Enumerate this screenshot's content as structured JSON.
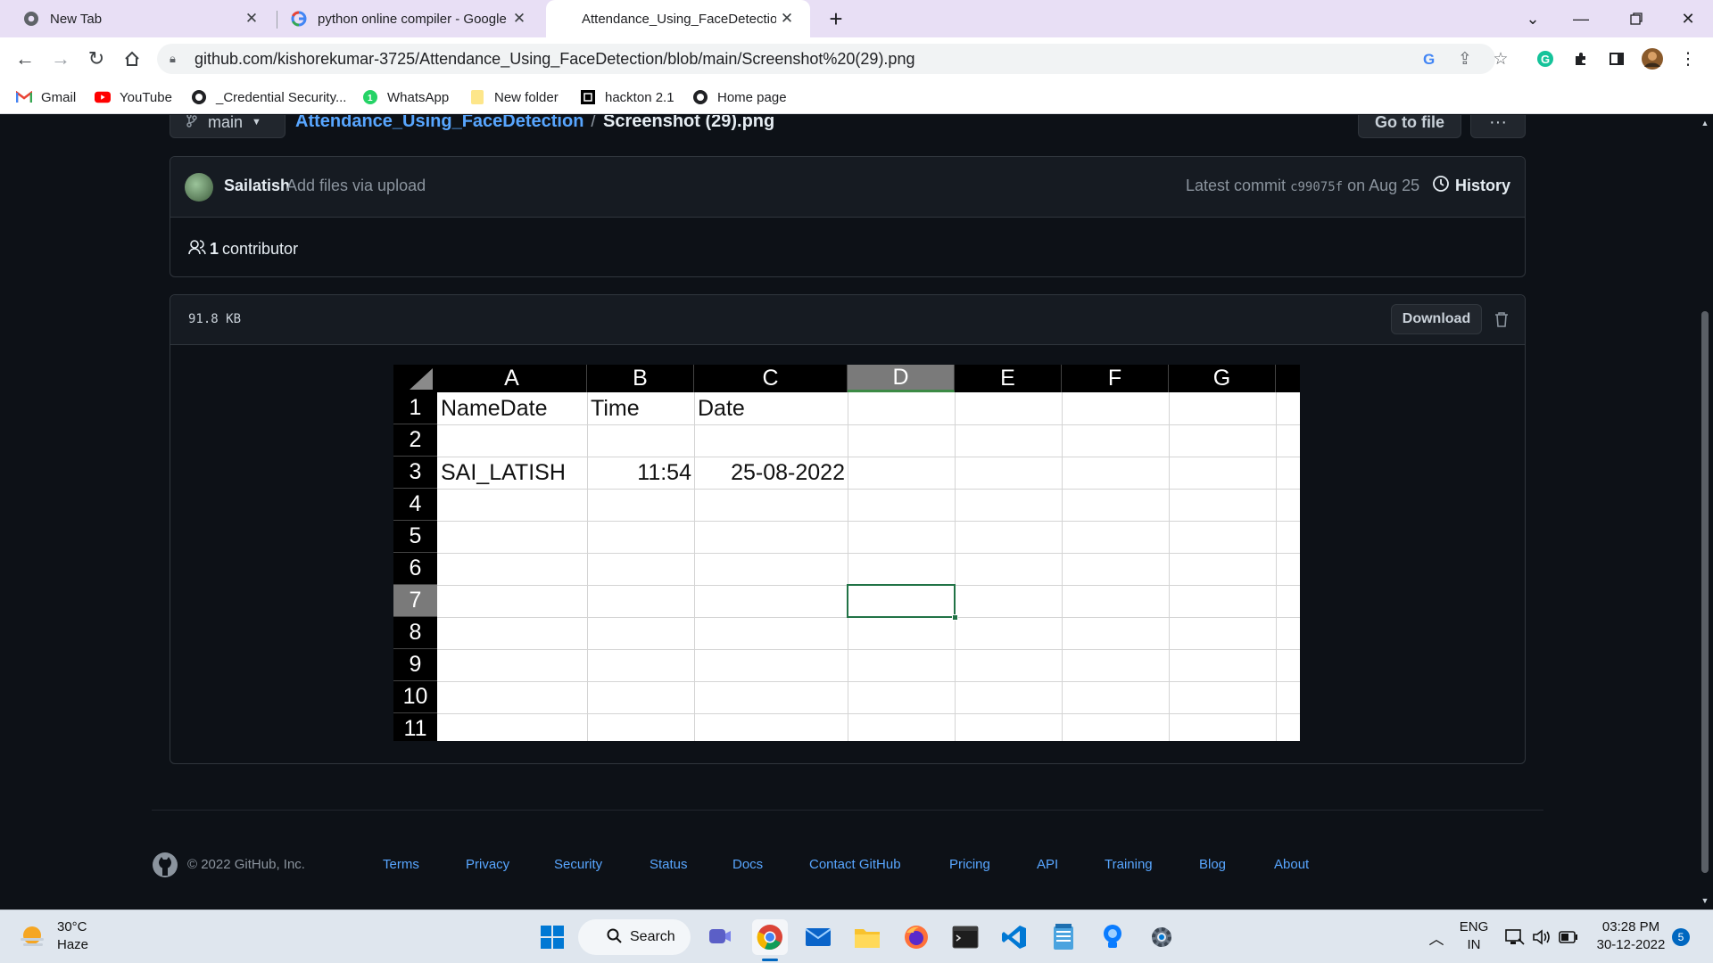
{
  "browser": {
    "tabs": [
      {
        "title": "New Tab"
      },
      {
        "title": "python online compiler - Google"
      },
      {
        "title": "Attendance_Using_FaceDetection"
      }
    ],
    "url": "github.com/kishorekumar-3725/Attendance_Using_FaceDetection/blob/main/Screenshot%20(29).png",
    "bookmarks": [
      {
        "label": "Gmail"
      },
      {
        "label": "YouTube"
      },
      {
        "label": "_Credential Security..."
      },
      {
        "label": "WhatsApp"
      },
      {
        "label": "New folder"
      },
      {
        "label": "hackton 2.1"
      },
      {
        "label": "Home page"
      }
    ]
  },
  "repo": {
    "branch": "main",
    "repo_name": "Attendance_Using_FaceDetection",
    "separator": "/",
    "file_name": "Screenshot (29).png",
    "go_to_file": "Go to file",
    "more": "···"
  },
  "commit": {
    "author": "Sailatish",
    "message": "Add files via upload",
    "latest_prefix": "Latest commit",
    "sha": "c99075f",
    "date": "on Aug 25",
    "history": "History",
    "contributors_count": "1",
    "contributors_label": "contributor"
  },
  "file": {
    "size": "91.8 KB",
    "download": "Download"
  },
  "spreadsheet": {
    "columns": [
      "A",
      "B",
      "C",
      "D",
      "E",
      "F",
      "G"
    ],
    "selected_column": "D",
    "rows": [
      "1",
      "2",
      "3",
      "4",
      "5",
      "6",
      "7",
      "8",
      "9",
      "10",
      "11"
    ],
    "selected_row": "7",
    "cells": {
      "A1": "NameDate",
      "B1": "Time",
      "C1": "Date",
      "A3": "SAI_LATISH",
      "B3": "11:54",
      "C3": "25-08-2022"
    }
  },
  "footer": {
    "copyright": "© 2022 GitHub, Inc.",
    "links": [
      "Terms",
      "Privacy",
      "Security",
      "Status",
      "Docs",
      "Contact GitHub",
      "Pricing",
      "API",
      "Training",
      "Blog",
      "About"
    ]
  },
  "taskbar": {
    "temperature": "30°C",
    "condition": "Haze",
    "search_label": "Search",
    "language": "ENG",
    "region": "IN",
    "time": "03:28 PM",
    "date": "30-12-2022",
    "notifications": "5"
  },
  "colors": {
    "page_bg": "#0d1117",
    "link": "#58a6ff",
    "tab_strip": "#e8dff5"
  }
}
